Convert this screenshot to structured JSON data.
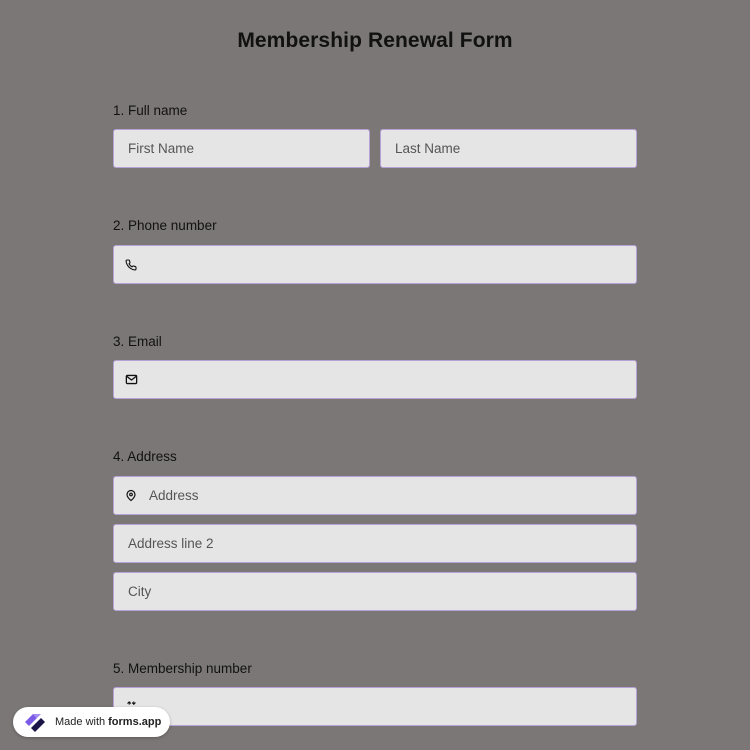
{
  "form": {
    "title": "Membership Renewal Form",
    "accent_border": "#b6a1d6",
    "field_bg": "#e6e5e5",
    "page_bg": "#7b7776"
  },
  "questions": [
    {
      "label": "1.  Full name",
      "fields": [
        {
          "placeholder": "First Name",
          "value": ""
        },
        {
          "placeholder": "Last Name",
          "value": ""
        }
      ]
    },
    {
      "label": "2. Phone number",
      "icon": "phone-icon",
      "fields": [
        {
          "placeholder": "",
          "value": ""
        }
      ]
    },
    {
      "label": "3. Email",
      "icon": "mail-icon",
      "fields": [
        {
          "placeholder": "",
          "value": ""
        }
      ]
    },
    {
      "label": "4. Address",
      "fields": [
        {
          "placeholder": "Address",
          "value": "",
          "icon": "location-pin-icon"
        },
        {
          "placeholder": "Address line 2",
          "value": ""
        },
        {
          "placeholder": "City",
          "value": ""
        }
      ]
    },
    {
      "label": "5. Membership number",
      "icon": "number-arrows-icon",
      "fields": [
        {
          "placeholder": "",
          "value": ""
        }
      ]
    }
  ],
  "badge": {
    "prefix": "Made with",
    "brand": "forms.app",
    "logo_icon": "forms-app-logo-icon"
  }
}
